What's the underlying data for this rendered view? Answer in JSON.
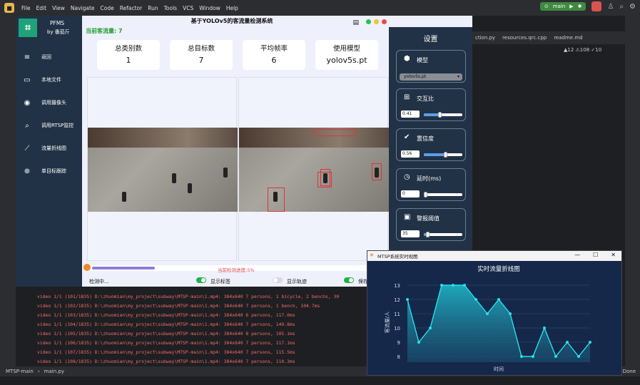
{
  "ide": {
    "menu": [
      "File",
      "Edit",
      "View",
      "Navigate",
      "Code",
      "Refactor",
      "Run",
      "Tools",
      "VCS",
      "Window",
      "Help"
    ],
    "branch": "main",
    "tabs": [
      "ction.py",
      "resources.qrc.cpp",
      "readme.md"
    ],
    "warnings": "▲12  ⚠108  ✓10",
    "status_path": [
      "MTSP-main",
      "main.py"
    ],
    "status_right": "Done",
    "terminal_lines": [
      "video 1/1 (101/1835) D:\\zhuomian\\my_project\\subway\\MTSP-main\\1.mp4: 384x640 7 persons, 1 bicycle, 2 benchs, 30",
      "video 1/1 (102/1835) D:\\zhuomian\\my_project\\subway\\MTSP-main\\1.mp4: 384x640 7 persons, 1 bench, 104.7ms",
      "video 1/1 (103/1835) D:\\zhuomian\\my_project\\subway\\MTSP-main\\1.mp4: 384x640 6 persons, 117.0ms",
      "video 1/1 (104/1835) D:\\zhuomian\\my_project\\subway\\MTSP-main\\1.mp4: 384x640 7 persons, 149.8ms",
      "video 1/1 (105/1835) D:\\zhuomian\\my_project\\subway\\MTSP-main\\1.mp4: 384x640 8 persons, 105.1ms",
      "video 1/1 (106/1835) D:\\zhuomian\\my_project\\subway\\MTSP-main\\1.mp4: 384x640 7 persons, 117.1ms",
      "video 1/1 (107/1835) D:\\zhuomian\\my_project\\subway\\MTSP-main\\1.mp4: 384x640 7 persons, 115.5ms",
      "video 1/1 (108/1835) D:\\zhuomian\\my_project\\subway\\MTSP-main\\1.mp4: 384x640 7 persons, 110.3ms"
    ]
  },
  "app": {
    "name": "PFMS",
    "by": "by 番茄斤",
    "title": "基于YOLOv5的客流量检测系统",
    "current_flow": "当前客流量: 7",
    "nav": [
      {
        "label": "返回",
        "icon": "menu-icon",
        "glyph": "≡"
      },
      {
        "label": "本地文件",
        "icon": "folder-icon",
        "glyph": "▭"
      },
      {
        "label": "调用摄像头",
        "icon": "camera-icon",
        "glyph": "◉"
      },
      {
        "label": "调用RTSP监控",
        "icon": "cctv-icon",
        "glyph": "⌕"
      },
      {
        "label": "流量折线图",
        "icon": "line-chart-icon",
        "glyph": "⟋"
      },
      {
        "label": "单目标跟踪",
        "icon": "target-icon",
        "glyph": "⊕"
      }
    ],
    "stats": [
      {
        "label": "总类别数",
        "value": "1"
      },
      {
        "label": "总目标数",
        "value": "7"
      },
      {
        "label": "平均帧率",
        "value": "6"
      },
      {
        "label": "使用模型",
        "value": "yolov5s.pt"
      }
    ],
    "progress_text": "当前检测进度:5%",
    "progress": 0.05,
    "status": "检测中...",
    "toggles": [
      {
        "label": "显示标签",
        "on": true
      },
      {
        "label": "显示轨迹",
        "on": false
      },
      {
        "label": "保存为 M",
        "on": true
      }
    ],
    "settings": {
      "title": "设置",
      "model": {
        "label": "模型",
        "value": "yolov5s.pt"
      },
      "iou": {
        "label": "交互比",
        "value": "0.41",
        "level": 0.41
      },
      "conf": {
        "label": "置信度",
        "value": "0.56",
        "level": 0.56
      },
      "delay": {
        "label": "延时(ms)",
        "value": "0",
        "level": 0.0
      },
      "alarm": {
        "label": "警报阈值",
        "value": "35",
        "level": 0.1
      }
    }
  },
  "chart_window": {
    "title": "MTSP系统实时视图",
    "controls": [
      "—",
      "☐",
      "✕"
    ]
  },
  "chart_data": {
    "type": "area",
    "title": "实时流量折线图",
    "xlabel": "时间",
    "ylabel": "客流量/人",
    "ylim": [
      7.6,
      13.2
    ],
    "yticks": [
      8,
      9,
      10,
      11,
      12,
      13
    ],
    "values": [
      12,
      9,
      10,
      13,
      13,
      13,
      12,
      11,
      12,
      11,
      8,
      8,
      10,
      8,
      9,
      8,
      9
    ]
  }
}
